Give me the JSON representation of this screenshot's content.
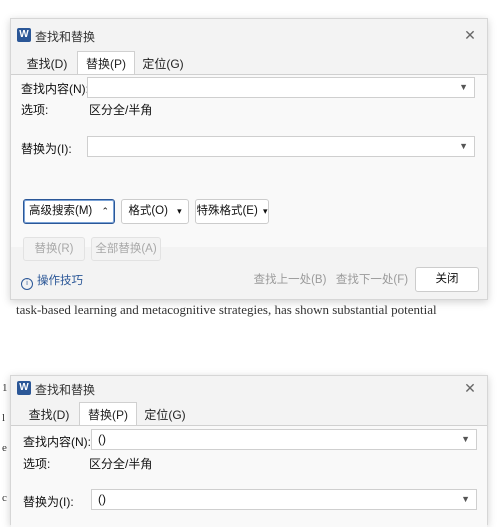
{
  "dialog_top": {
    "title": "查找和替换",
    "app_badge": "W",
    "close_glyph": "✕",
    "tabs": [
      "查找(D)",
      "替换(P)",
      "定位(G)"
    ],
    "active_tab": "替换(P)",
    "find_label": "查找内容(N):",
    "find_value": "",
    "options_label": "选项:",
    "options_value": "区分全/半角",
    "replace_label": "替换为(I):",
    "replace_value": "",
    "advanced_button": "高级搜索(M)",
    "advanced_chevron": "⌃",
    "format_button": "格式(O)",
    "special_format_button": "特殊格式(E)",
    "dropdown_arrow": "▾",
    "replace_button": "替换(R)",
    "replace_all_button": "全部替换(A)",
    "tips_link": "操作技巧",
    "find_prev_button": "查找上一处(B)",
    "find_next_button": "查找下一处(F)",
    "close_button": "关闭"
  },
  "background_text": "task-based learning and metacognitive strategies, has shown substantial potential",
  "dialog_bottom": {
    "title": "查找和替换",
    "app_badge": "W",
    "close_glyph": "✕",
    "tabs": [
      "查找(D)",
      "替换(P)",
      "定位(G)"
    ],
    "active_tab": "替换(P)",
    "find_label": "查找内容(N):",
    "find_value": "()",
    "options_label": "选项:",
    "options_value": "区分全/半角",
    "replace_label": "替换为(I):",
    "replace_value": "()"
  },
  "bg_left_chars": [
    "1",
    "l",
    "e",
    "c"
  ],
  "colors": {
    "accent": "#2b5797",
    "dialog_bg": "#f3f3f3"
  }
}
